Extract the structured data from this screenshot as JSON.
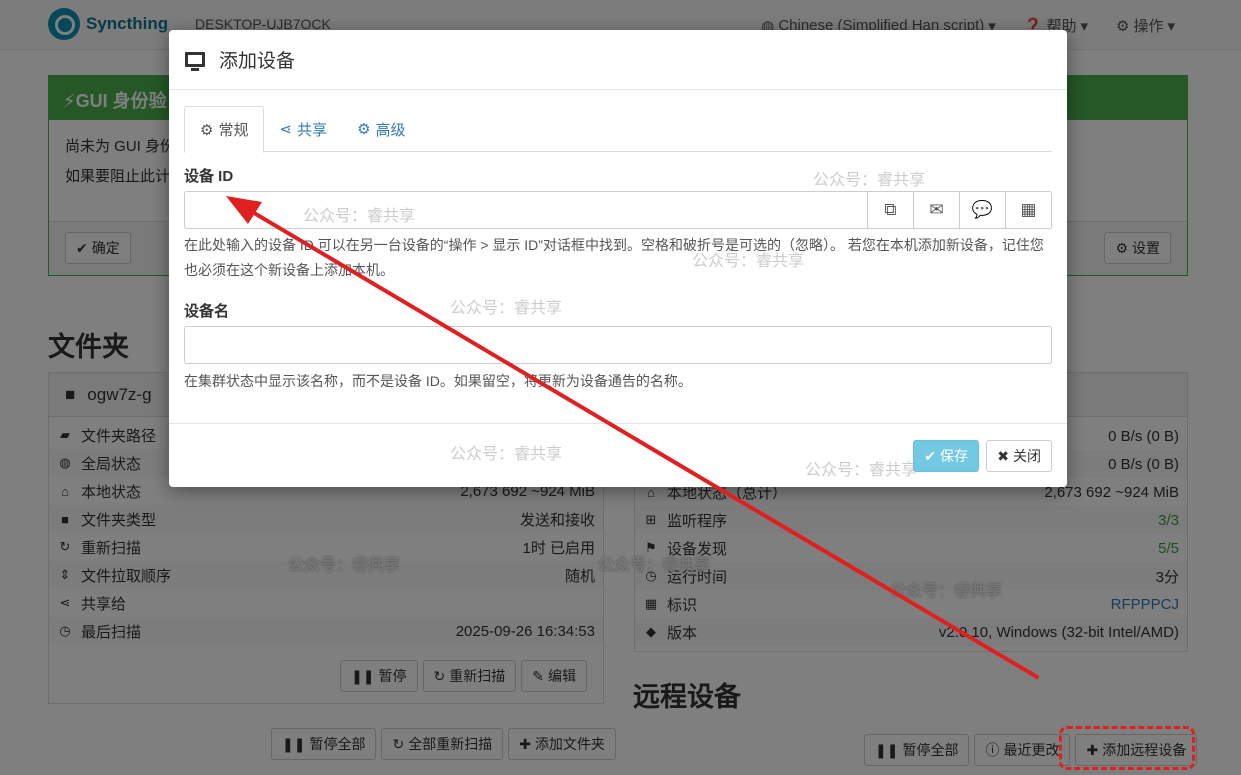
{
  "navbar": {
    "brand": "Syncthing",
    "hostname": "DESKTOP-UJB7OCK",
    "language": "Chinese (Simplified Han script)",
    "help": "帮助",
    "actions": "操作"
  },
  "alert": {
    "title": "GUI 身份验",
    "line1": "尚未为 GUI 身份",
    "line2": "如果要阻止此计",
    "ok_button": "确定",
    "settings_button": "设置"
  },
  "folders": {
    "heading": "文件夹",
    "folder_name": "ogw7z-g",
    "rows": [
      {
        "label": "文件夹路径",
        "icon": "folder-open-icon",
        "value": ""
      },
      {
        "label": "全局状态",
        "icon": "globe-icon",
        "value": ""
      },
      {
        "label": "本地状态",
        "icon": "home-icon",
        "value": "2,673  692  ~924 MiB"
      },
      {
        "label": "文件夹类型",
        "icon": "folder-icon",
        "value": "发送和接收"
      },
      {
        "label": "重新扫描",
        "icon": "refresh-icon",
        "value": "1时  已启用"
      },
      {
        "label": "文件拉取顺序",
        "icon": "sort-icon",
        "value": "随机"
      },
      {
        "label": "共享给",
        "icon": "share-icon",
        "value": ""
      },
      {
        "label": "最后扫描",
        "icon": "clock-icon",
        "value": "2025-09-26 16:34:53"
      }
    ],
    "pause_button": "暂停",
    "rescan_button": "重新扫描",
    "edit_button": "编辑",
    "pause_all_button": "暂停全部",
    "rescan_all_button": "全部重新扫描",
    "add_folder_button": "添加文件夹"
  },
  "this_device": {
    "rows": [
      {
        "label": "",
        "icon": "",
        "value": "0 B/s (0 B)"
      },
      {
        "label": "",
        "icon": "",
        "value": "0 B/s (0 B)"
      },
      {
        "label": "本地状态（总计）",
        "icon": "home-icon",
        "value": "2,673  692  ~924 MiB"
      },
      {
        "label": "监听程序",
        "icon": "sitemap-icon",
        "value": "3/3"
      },
      {
        "label": "设备发现",
        "icon": "signpost-icon",
        "value": "5/5"
      },
      {
        "label": "运行时间",
        "icon": "clock-icon",
        "value": "3分"
      },
      {
        "label": "标识",
        "icon": "qrcode-icon",
        "value": "RFPPPCJ"
      },
      {
        "label": "版本",
        "icon": "tag-icon",
        "value": "v2.0.10, Windows (32-bit Intel/AMD)"
      }
    ]
  },
  "remote_devices": {
    "heading": "远程设备",
    "pause_all_button": "暂停全部",
    "recent_changes_button": "最近更改",
    "add_device_button": "添加远程设备"
  },
  "modal": {
    "title": "添加设备",
    "tabs": [
      "常规",
      "共享",
      "高级"
    ],
    "device_id_label": "设备 ID",
    "device_id_value": "",
    "device_id_help": "在此处输入的设备 ID 可以在另一台设备的“操作 > 显示 ID”对话框中找到。空格和破折号是可选的（忽略）。 若您在本机添加新设备，记住您也必须在这个新设备上添加本机。",
    "device_name_label": "设备名",
    "device_name_value": "",
    "device_name_help": "在集群状态中显示该名称，而不是设备 ID。如果留空，将更新为设备通告的名称。",
    "save_button": "保存",
    "close_button": "关闭"
  },
  "watermark": "公众号：睿共享",
  "colors": {
    "accent": "#337ab7",
    "alert_green": "#4cae4c",
    "annotation_red": "#e02020"
  }
}
